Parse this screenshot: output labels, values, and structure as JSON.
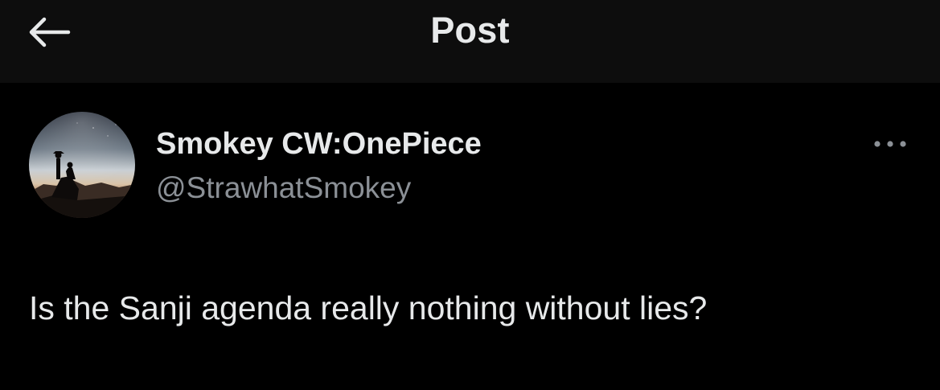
{
  "header": {
    "title": "Post",
    "back_icon": "arrow-left-icon"
  },
  "author": {
    "display_name": "Smokey CW:OnePiece",
    "handle": "@StrawhatSmokey",
    "avatar": "avatar-silhouette-night-sky"
  },
  "post": {
    "text": "Is the Sanji agenda really nothing without lies?",
    "more_icon": "more-options-icon"
  },
  "colors": {
    "background": "#000000",
    "header_background": "#0d0d0d",
    "primary_text": "#e7e9ea",
    "secondary_text": "#8b9096"
  }
}
